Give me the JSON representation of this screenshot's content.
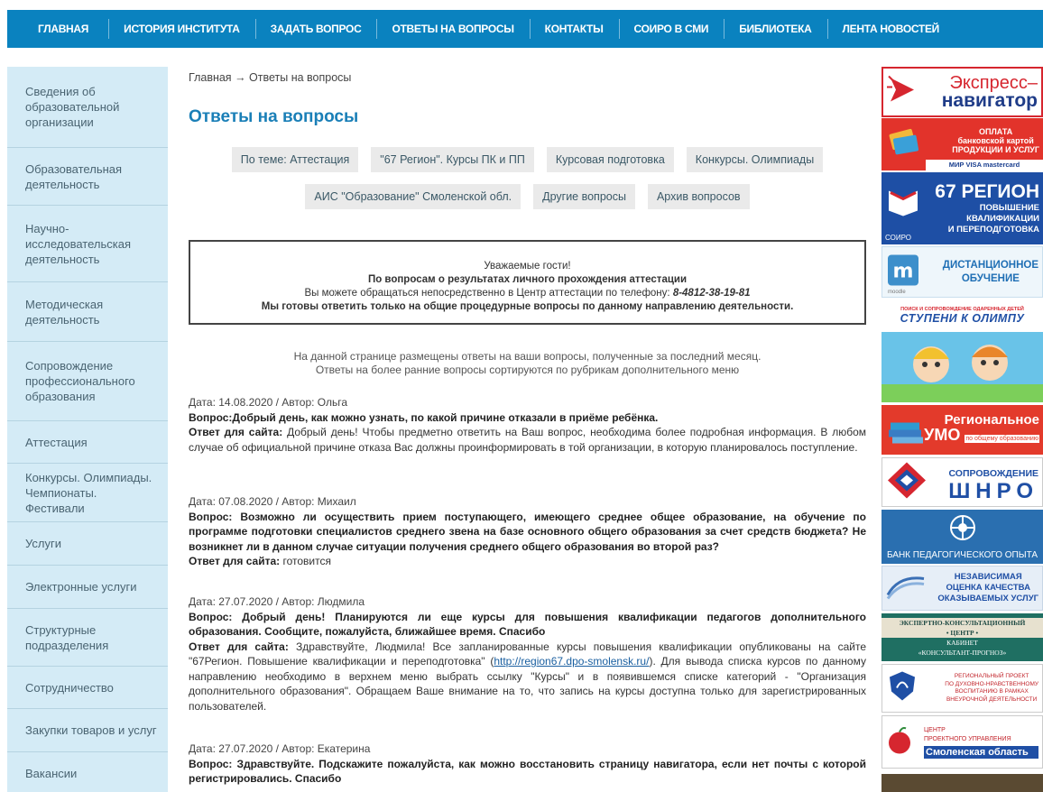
{
  "topnav": [
    {
      "label": "Главная"
    },
    {
      "label": "История института"
    },
    {
      "label": "Задать вопрос"
    },
    {
      "label": "Ответы на вопросы"
    },
    {
      "label": "Контакты"
    },
    {
      "label": "СОИРО в СМИ"
    },
    {
      "label": "Библиотека"
    },
    {
      "label": "Лента новостей"
    }
  ],
  "sidebar": [
    {
      "label": "Сведения об образовательной организации"
    },
    {
      "label": "Образовательная деятельность"
    },
    {
      "label": "Научно-исследовательская деятельность"
    },
    {
      "label": "Методическая деятельность"
    },
    {
      "label": "Сопровождение профессионального образования"
    },
    {
      "label": "Аттестация"
    },
    {
      "label": "Конкурсы. Олимпиады. Чемпионаты. Фестивали"
    },
    {
      "label": "Услуги"
    },
    {
      "label": "Электронные услуги"
    },
    {
      "label": "Структурные подразделения"
    },
    {
      "label": "Сотрудничество"
    },
    {
      "label": "Закупки товаров и услуг"
    },
    {
      "label": "Вакансии"
    }
  ],
  "breadcrumb": {
    "home": "Главная",
    "separator": "→",
    "current": "Ответы на вопросы"
  },
  "page_title": "Ответы на вопросы",
  "filters_row1": [
    {
      "label": "По теме: Аттестация"
    },
    {
      "label": "\"67 Регион\". Курсы ПК и ПП"
    },
    {
      "label": "Курсовая подготовка"
    },
    {
      "label": "Конкурсы. Олимпиады"
    }
  ],
  "filters_row2": [
    {
      "label": "АИС \"Образование\" Смоленской обл."
    },
    {
      "label": "Другие вопросы"
    },
    {
      "label": "Архив вопросов"
    }
  ],
  "notice": {
    "line1": "Уважаемые гости!",
    "line2": "По вопросам о результатах личного прохождения аттестации",
    "line3_prefix": "Вы можете обращаться непосредственно в Центр аттестации по телефону:",
    "phone": "8-4812-38-19-81",
    "line4": "Мы готовы ответить только на общие процедурные вопросы по данному направлению деятельности."
  },
  "intro": {
    "line1": "На данной странице размещены ответы на ваши вопросы, полученные за последний месяц.",
    "line2": "Ответы на более ранние вопросы сортируются по рубрикам дополнительного меню"
  },
  "qa": [
    {
      "meta": "Дата: 14.08.2020 / Автор: Ольга",
      "question": "Вопрос:Добрый день, как можно узнать, по какой причине отказали в приёме ребёнка.",
      "answer_label": "Ответ для сайта:",
      "answer": "Добрый день! Чтобы предметно ответить на Ваш вопрос, необходима более подробная информация. В любом случае об официальной причине отказа Вас должны проинформировать в той организации, в которую планировалось поступление."
    },
    {
      "meta": "Дата: 07.08.2020 / Автор: Михаил",
      "question": "Вопрос: Возможно ли осуществить прием поступающего, имеющего среднее общее образование, на обучение по программе подготовки специалистов среднего звена на базе основного общего образования за счет средств бюджета? Не возникнет ли в данном случае ситуации получения среднего общего образования во второй раз?",
      "answer_label": "Ответ для сайта:",
      "answer": "готовится"
    },
    {
      "meta": "Дата: 27.07.2020 / Автор: Людмила",
      "question": "Вопрос: Добрый день! Планируются ли еще курсы для повышения квалификации педагогов дополнительного образования. Сообщите, пожалуйста, ближайшее время. Спасибо",
      "answer_label": "Ответ для сайта:",
      "answer_before_link": "Здравствуйте, Людмила! Все запланированные курсы повышения квалификации опубликованы на сайте \"67Регион. Повышение квалификации и переподготовка\" (",
      "link": "http://region67.dpo-smolensk.ru/",
      "answer_after_link": "). Для вывода списка курсов по данному направлению необходимо в верхнем меню выбрать ссылку \"Курсы\" и в появившемся списке категорий - \"Организация дополнительного образования\". Обращаем Ваше внимание на то, что запись на курсы доступна только для зарегистрированных пользователей."
    },
    {
      "meta": "Дата: 27.07.2020 / Автор: Екатерина",
      "question": "Вопрос: Здравствуйте. Подскажите пожалуйста, как можно восстановить страницу навигатора, если нет почты с которой регистрировались. Спасибо",
      "answer_label": "",
      "answer": ""
    }
  ],
  "banners": {
    "express_line1": "Экспресс–",
    "express_line2": "навигатор",
    "pay_line1": "ОПЛАТА",
    "pay_line2": "банковской картой",
    "pay_line3": "ПРОДУКЦИИ И УСЛУГ",
    "pay_cards": "МИР  VISA  mastercard",
    "region_big": "67 РЕГИОН",
    "region_l1": "ПОВЫШЕНИЕ",
    "region_l2": "КВАЛИФИКАЦИИ",
    "region_l3": "И ПЕРЕПОДГОТОВКА",
    "region_soiro": "СОИРО",
    "moodle_l1": "ДИСТАНЦИОННОЕ",
    "moodle_l2": "ОБУЧЕНИЕ",
    "moodle_small": "moodle",
    "steps_small": "ПОИСК И СОПРОВОЖДЕНИЕ ОДАРЕННЫХ ДЕТЕЙ",
    "steps_big": "СТУПЕНИ К ОЛИМПУ",
    "umo_l1": "Региональное",
    "umo_l2": "УМО",
    "umo_l3": "по общему образованию",
    "shnro_l1": "СОПРОВОЖДЕНИЕ",
    "shnro_l2": "ШНРО",
    "bank": "БАНК ПЕДАГОГИЧЕСКОГО ОПЫТА",
    "nok_l1": "НЕЗАВИСИМАЯ",
    "nok_l2": "ОЦЕНКА КАЧЕСТВА",
    "nok_l3": "ОКАЗЫВАЕМЫХ УСЛУГ",
    "cab_l1": "ЭКСПЕРТНО-КОНСУЛЬТАЦИОННЫЙ",
    "cab_l2": "• ЦЕНТР •",
    "cab_l3": "КАБИНЕТ",
    "cab_l4": "«КОНСУЛЬТАНТ-ПРОГНОЗ»",
    "dnv_l1": "РЕГИОНАЛЬНЫЙ ПРОЕКТ",
    "dnv_l2": "ПО ДУХОВНО-НРАВСТВЕННОМУ",
    "dnv_l3": "ВОСПИТАНИЮ В РАМКАХ",
    "dnv_l4": "ВНЕУРОЧНОЙ ДЕЯТЕЛЬНОСТИ",
    "proj_l1": "ЦЕНТР",
    "proj_l2": "ПРОЕКТНОГО УПРАВЛЕНИЯ",
    "proj_l3": "Смоленская область"
  }
}
